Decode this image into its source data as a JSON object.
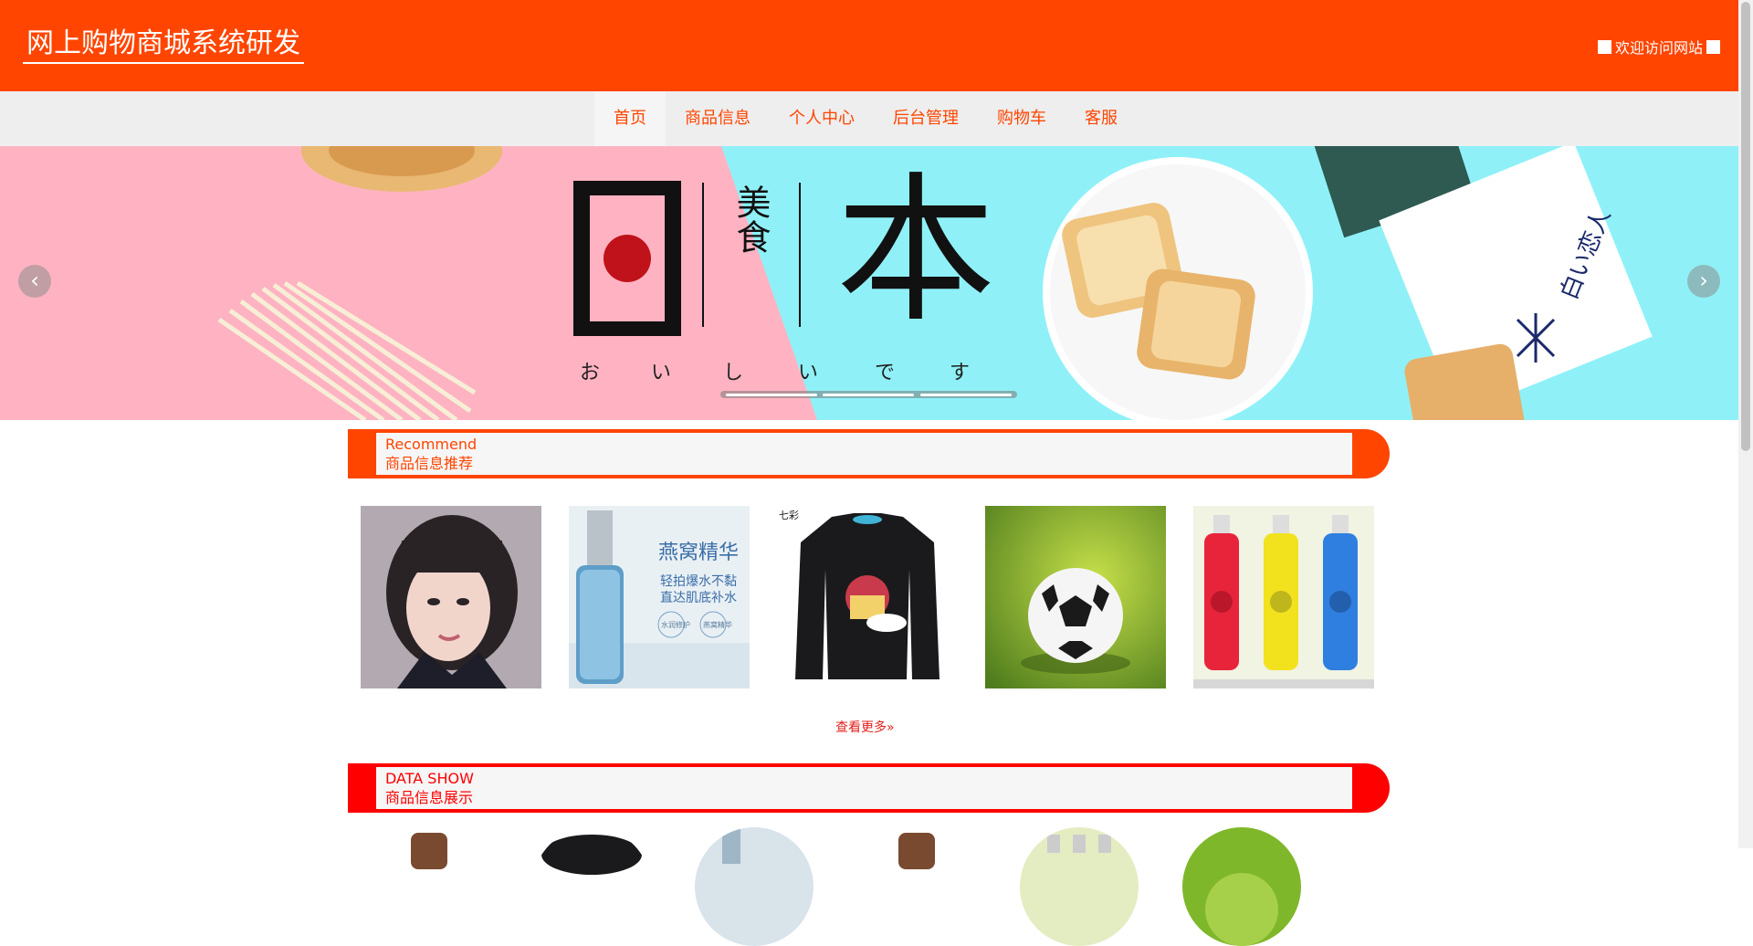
{
  "header": {
    "title": "网上购物商城系统研发",
    "welcome": "欢迎访问网站"
  },
  "nav": {
    "items": [
      "首页",
      "商品信息",
      "个人中心",
      "后台管理",
      "购物车",
      "客服"
    ],
    "active_index": 0
  },
  "banner": {
    "headline": "日本",
    "side_chars": "美食",
    "tagline": [
      "お",
      "い",
      "し",
      "い",
      "で",
      "す"
    ],
    "package_text": "白い恋人",
    "slides_count": 3,
    "prev_icon": "chevron-left-icon",
    "next_icon": "chevron-right-icon"
  },
  "recommend": {
    "title_en": "Recommend",
    "title_cn": "商品信息推荐",
    "accent": "#ff4500",
    "products": [
      {
        "name": "girl-portrait"
      },
      {
        "name": "perfume-serum",
        "text_main": "燕窝精华",
        "text_sub1": "轻拍爆水不黏",
        "text_sub2": "直达肌底补水",
        "tag1": "水润修护",
        "tag2": "燕窝精华"
      },
      {
        "name": "black-tshirt",
        "tag": "七彩"
      },
      {
        "name": "soccer-ball"
      },
      {
        "name": "colored-bottles"
      }
    ],
    "more_label": "查看更多",
    "more_icon": "double-chevron-right-icon"
  },
  "datashow": {
    "title_en": "DATA SHOW",
    "title_cn": "商品信息展示",
    "accent": "#ff0000"
  }
}
